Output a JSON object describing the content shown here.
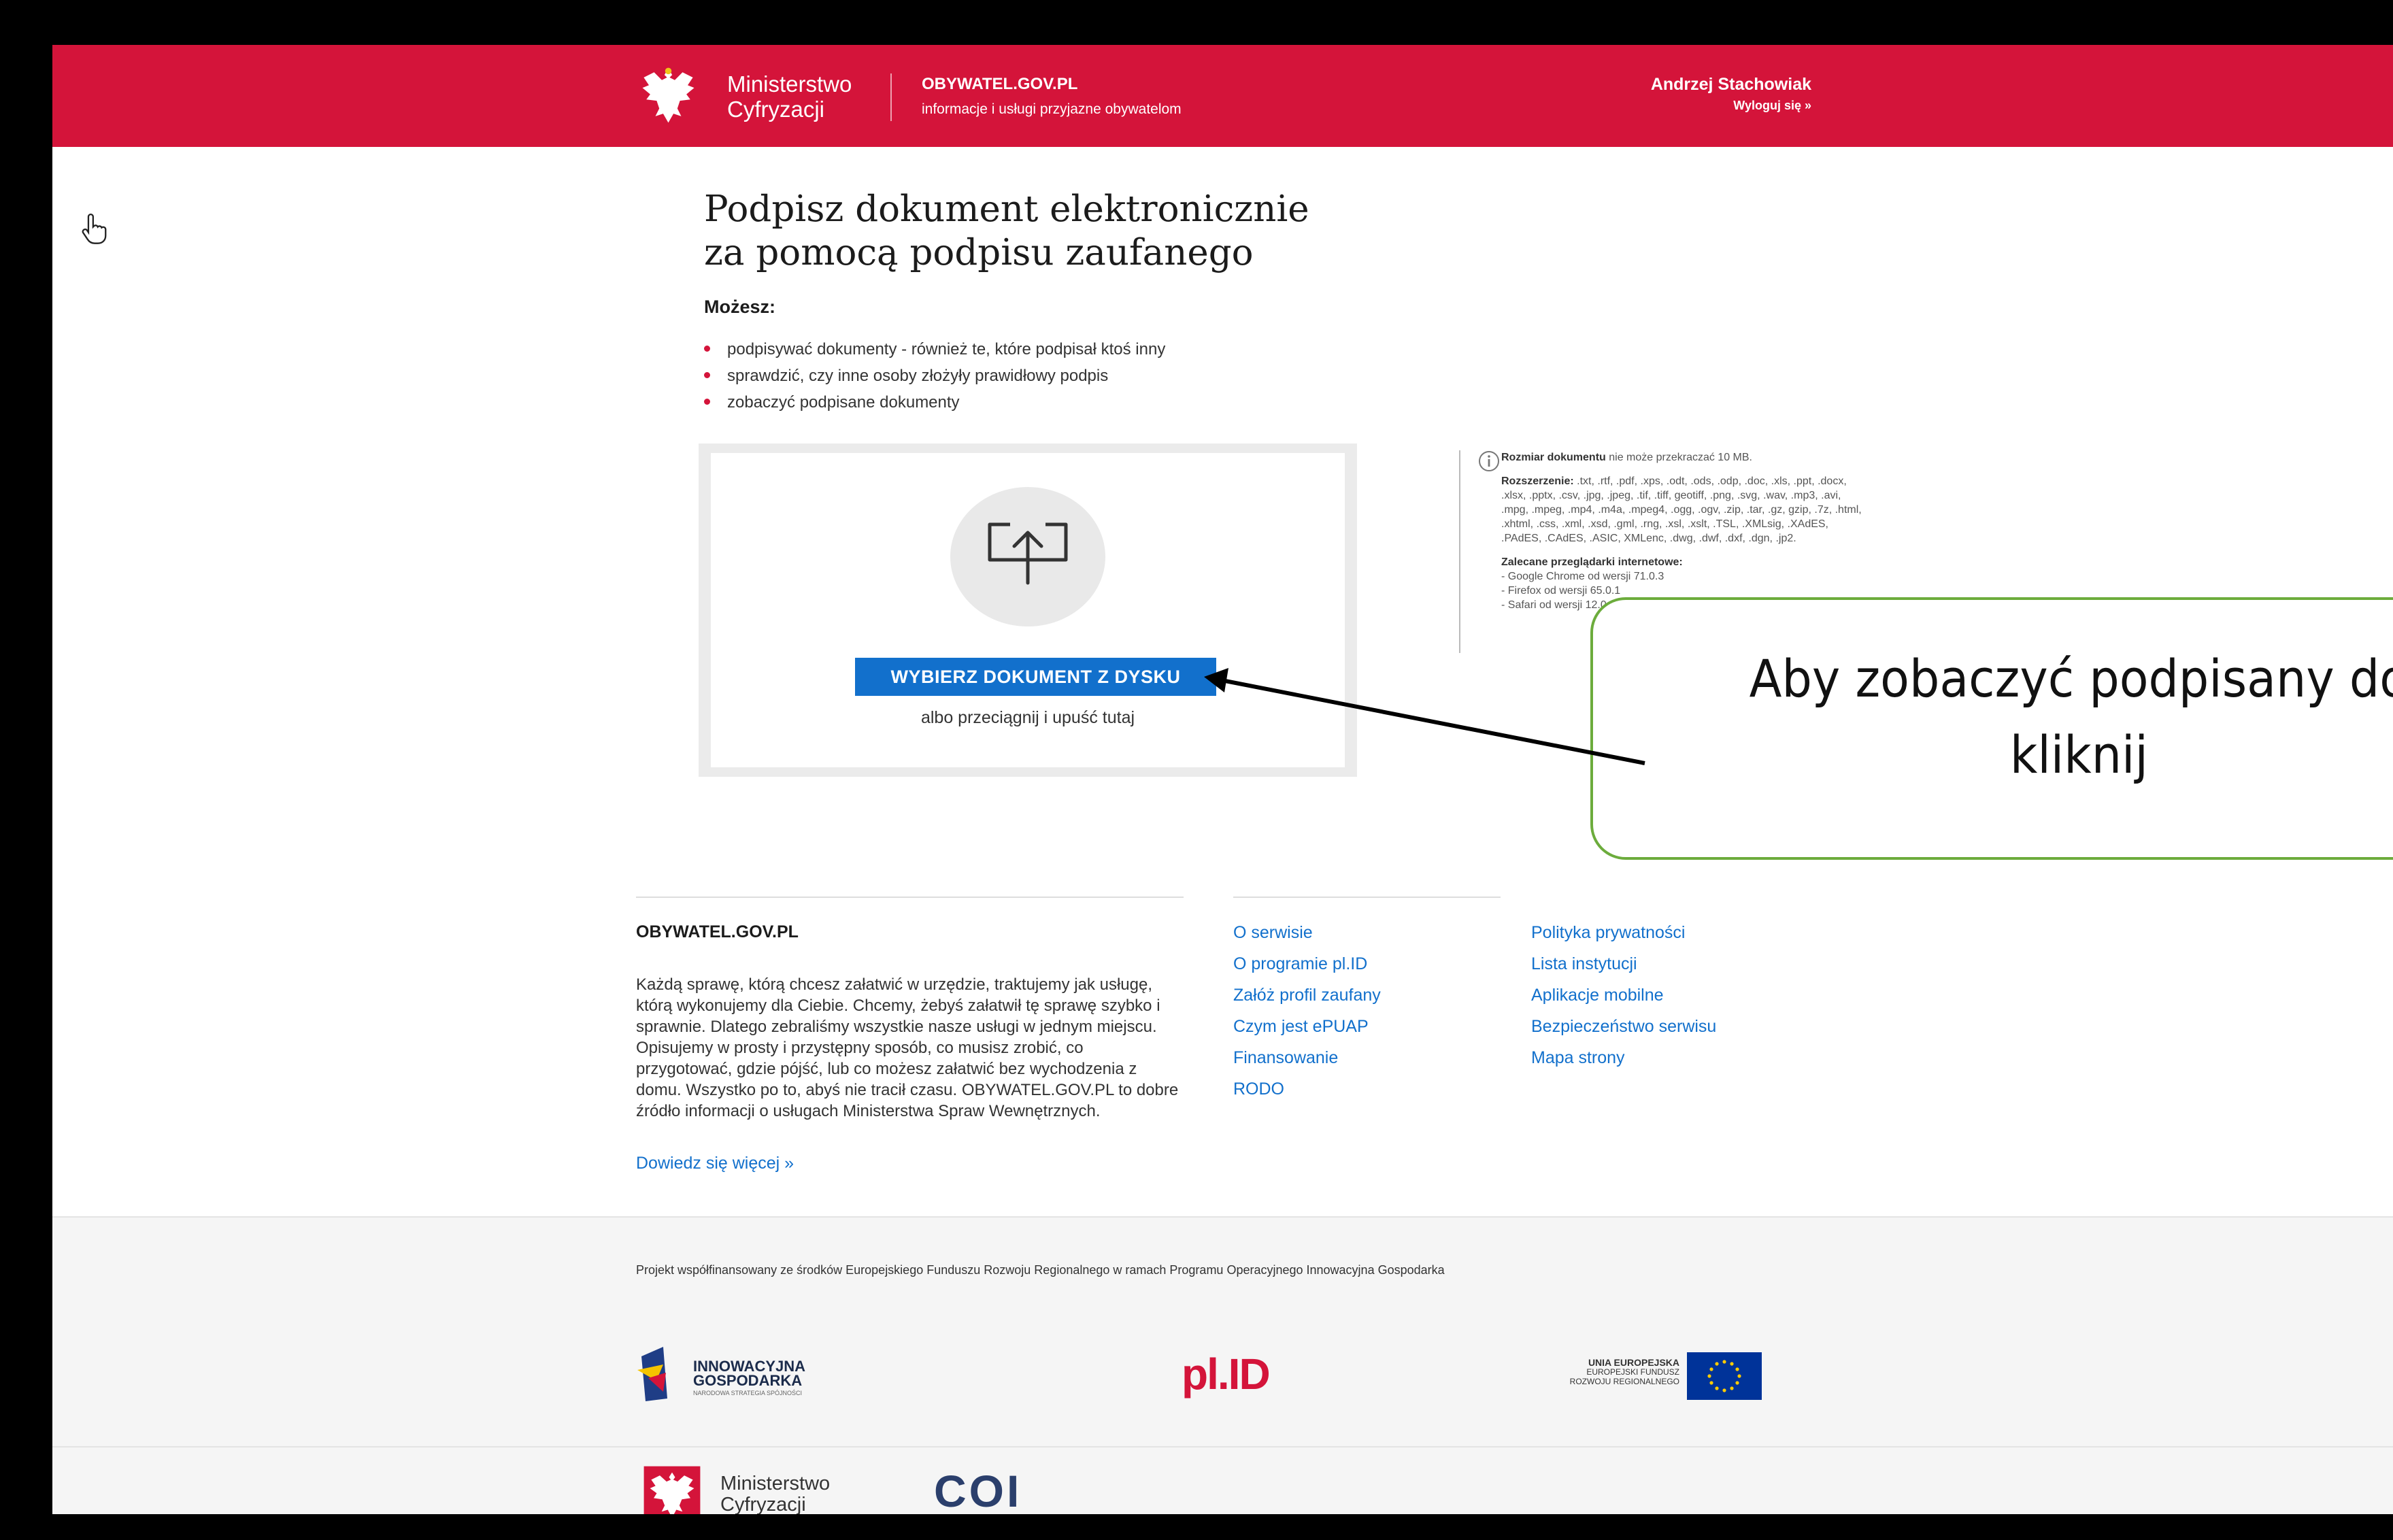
{
  "header": {
    "ministry": "Ministerstwo\nCyfryzacji",
    "portal_name": "OBYWATEL.GOV.PL",
    "portal_tagline": "informacje i usługi przyjazne obywatelom",
    "user_name": "Andrzej Stachowiak",
    "logout": "Wyloguj się »"
  },
  "main": {
    "title": "Podpisz dokument elektronicznie\nza pomocą podpisu zaufanego",
    "can_label": "Możesz:",
    "bullets": [
      "podpisywać dokumenty - również te, które podpisał ktoś inny",
      "sprawdzić, czy inne osoby złożyły prawidłowy podpis",
      "zobaczyć podpisane dokumenty"
    ],
    "upload_button": "WYBIERZ DOKUMENT Z DYSKU",
    "drop_hint": "albo przeciągnij i upuść tutaj"
  },
  "info": {
    "size_label": "Rozmiar dokumentu",
    "size_text": " nie może przekraczać 10 MB.",
    "ext_label": "Rozszerzenie:",
    "ext_text": " .txt, .rtf, .pdf, .xps, .odt, .ods, .odp, .doc, .xls, .ppt, .docx, .xlsx, .pptx, .csv, .jpg, .jpeg, .tif, .tiff, geotiff, .png, .svg, .wav, .mp3, .avi, .mpg, .mpeg, .mp4, .m4a, .mpeg4, .ogg, .ogv, .zip, .tar, .gz, gzip, .7z, .html, .xhtml, .css, .xml, .xsd, .gml, .rng, .xsl, .xslt, .TSL, .XMLsig, .XAdES, .PAdES, .CAdES, .ASIC, XMLenc, .dwg, .dwf, .dxf, .dgn, .jp2.",
    "browsers_label": "Zalecane przeglądarki internetowe:",
    "browsers": [
      "- Google Chrome od wersji 71.0.3",
      "- Firefox od wersji 65.0.1",
      "- Safari od wersji 12.0.2"
    ]
  },
  "callout": {
    "text": "Aby zobaczyć podpisany do\nkliknij"
  },
  "footer": {
    "title": "OBYWATEL.GOV.PL",
    "description": "Każdą sprawę, którą chcesz załatwić w urzędzie, traktujemy jak usługę, którą wykonujemy dla Ciebie. Chcemy, żebyś załatwił tę sprawę szybko i sprawnie. Dlatego zebraliśmy wszystkie nasze usługi w jednym miejscu. Opisujemy w prosty i przystępny sposób, co musisz zrobić, co przygotować, gdzie pójść, lub co możesz załatwić bez wychodzenia z domu. Wszystko po to, abyś nie tracił czasu. OBYWATEL.GOV.PL to dobre źródło informacji o usługach Ministerstwa Spraw Wewnętrznych.",
    "more": "Dowiedz się więcej »",
    "links_col1": [
      "O serwisie",
      "O programie pl.ID",
      "Załóż profil zaufany",
      "Czym jest ePUAP",
      "Finansowanie",
      "RODO"
    ],
    "links_col2": [
      "Polityka prywatności",
      "Lista instytucji",
      "Aplikacje mobilne",
      "Bezpieczeństwo serwisu",
      "Mapa strony"
    ],
    "funding": "Projekt współfinansowany ze środków Europejskiego Funduszu Rozwoju Regionalnego w ramach Programu Operacyjnego Innowacyjna Gospodarka",
    "ig_logo": "INNOWACYJNA\nGOSPODARKA",
    "ig_sub": "NARODOWA STRATEGIA SPÓJNOŚCI",
    "plid": "pl.ID",
    "eu_title": "UNIA EUROPEJSKA",
    "eu_sub": "EUROPEJSKI FUNDUSZ\nROZWOJU REGIONALNEGO",
    "ministry": "Ministerstwo\nCyfryzacji",
    "coi": "COI"
  },
  "colors": {
    "brand_red": "#d4143a",
    "link_blue": "#1270cc",
    "callout_green": "#6cac3c"
  },
  "icons": [
    "eagle-emblem-icon",
    "hand-cursor-icon",
    "upload-icon",
    "info-icon",
    "eu-flag-icon"
  ]
}
